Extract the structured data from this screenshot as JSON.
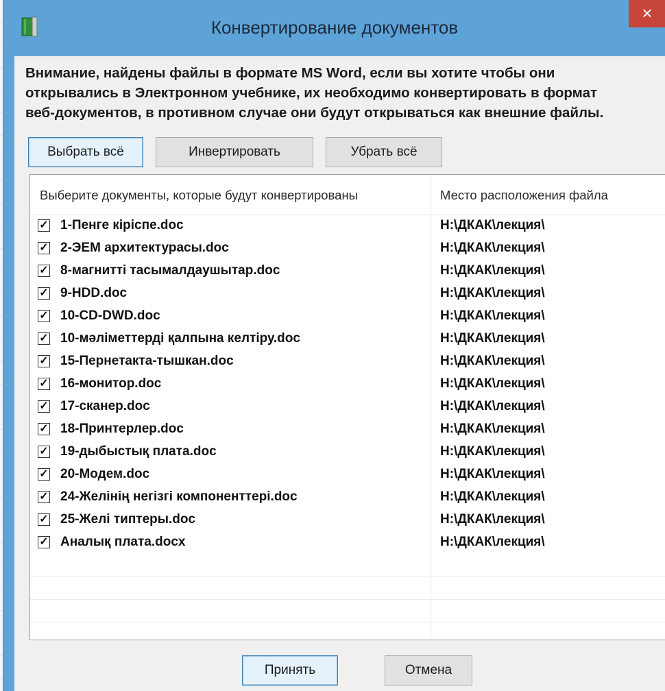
{
  "window": {
    "title": "Конвертирование документов",
    "close_glyph": "×",
    "accent_color": "#5ea3d8"
  },
  "notice": {
    "line1": "Внимание, найдены файлы в формате MS Word, если вы хотите чтобы они",
    "line2": "открывались в Электронном учебнике, их необходимо конвертировать в формат",
    "line3": "веб-документов, в противном случае они будут открываться как внешние файлы."
  },
  "toolbar": {
    "select_all": "Выбрать всё",
    "invert": "Инвертировать",
    "deselect_all": "Убрать всё"
  },
  "list": {
    "col_documents": "Выберите документы, которые будут конвертированы",
    "col_location": "Место расположения файла",
    "checked_glyph": "✓",
    "rows": [
      {
        "name": "1-Пенге кіріспе.doc",
        "location": "H:\\ДКАК\\лекция\\",
        "checked": true
      },
      {
        "name": "2-ЭЕМ архитектурасы.doc",
        "location": "H:\\ДКАК\\лекция\\",
        "checked": true
      },
      {
        "name": "8-магнитті тасымалдаушытар.doc",
        "location": "H:\\ДКАК\\лекция\\",
        "checked": true
      },
      {
        "name": "9-HDD.doc",
        "location": "H:\\ДКАК\\лекция\\",
        "checked": true
      },
      {
        "name": "10-CD-DWD.doc",
        "location": "H:\\ДКАК\\лекция\\",
        "checked": true
      },
      {
        "name": "10-мәліметтерді қалпына келтіру.doc",
        "location": "H:\\ДКАК\\лекция\\",
        "checked": true
      },
      {
        "name": "15-Пернетакта-тышкан.doc",
        "location": "H:\\ДКАК\\лекция\\",
        "checked": true
      },
      {
        "name": "16-монитор.doc",
        "location": "H:\\ДКАК\\лекция\\",
        "checked": true
      },
      {
        "name": "17-сканер.doc",
        "location": "H:\\ДКАК\\лекция\\",
        "checked": true
      },
      {
        "name": "18-Принтерлер.doc",
        "location": "H:\\ДКАК\\лекция\\",
        "checked": true
      },
      {
        "name": "19-дыбыстық плата.doc",
        "location": "H:\\ДКАК\\лекция\\",
        "checked": true
      },
      {
        "name": "20-Модем.doc",
        "location": "H:\\ДКАК\\лекция\\",
        "checked": true
      },
      {
        "name": "24-Желінің негізгі компоненттері.doc",
        "location": "H:\\ДКАК\\лекция\\",
        "checked": true
      },
      {
        "name": "25-Желі типтеры.doc",
        "location": "H:\\ДКАК\\лекция\\",
        "checked": true
      },
      {
        "name": "Аналық плата.docx",
        "location": "H:\\ДКАК\\лекция\\",
        "checked": true
      }
    ]
  },
  "footer": {
    "accept": "Принять",
    "cancel": "Отмена"
  }
}
